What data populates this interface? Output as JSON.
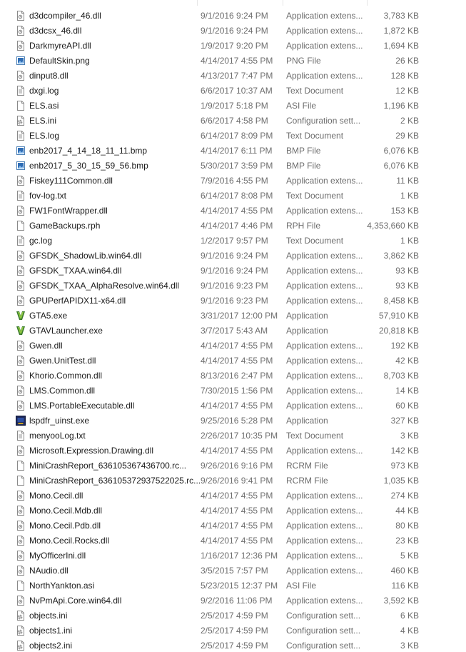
{
  "files": [
    {
      "name": "d3dcompiler_46.dll",
      "date": "9/1/2016 9:24 PM",
      "type": "Application extens...",
      "size": "3,783 KB",
      "icon": "dll-icon"
    },
    {
      "name": "d3dcsx_46.dll",
      "date": "9/1/2016 9:24 PM",
      "type": "Application extens...",
      "size": "1,872 KB",
      "icon": "dll-icon"
    },
    {
      "name": "DarkmyreAPI.dll",
      "date": "1/9/2017 9:20 PM",
      "type": "Application extens...",
      "size": "1,694 KB",
      "icon": "dll-icon"
    },
    {
      "name": "DefaultSkin.png",
      "date": "4/14/2017 4:55 PM",
      "type": "PNG File",
      "size": "26 KB",
      "icon": "image-icon"
    },
    {
      "name": "dinput8.dll",
      "date": "4/13/2017 7:47 PM",
      "type": "Application extens...",
      "size": "128 KB",
      "icon": "dll-icon"
    },
    {
      "name": "dxgi.log",
      "date": "6/6/2017 10:37 AM",
      "type": "Text Document",
      "size": "12 KB",
      "icon": "text-icon"
    },
    {
      "name": "ELS.asi",
      "date": "1/9/2017 5:18 PM",
      "type": "ASI File",
      "size": "1,196 KB",
      "icon": "file-icon"
    },
    {
      "name": "ELS.ini",
      "date": "6/6/2017 4:58 PM",
      "type": "Configuration sett...",
      "size": "2 KB",
      "icon": "config-icon"
    },
    {
      "name": "ELS.log",
      "date": "6/14/2017 8:09 PM",
      "type": "Text Document",
      "size": "29 KB",
      "icon": "text-icon"
    },
    {
      "name": "enb2017_4_14_18_11_11.bmp",
      "date": "4/14/2017 6:11 PM",
      "type": "BMP File",
      "size": "6,076 KB",
      "icon": "image-icon"
    },
    {
      "name": "enb2017_5_30_15_59_56.bmp",
      "date": "5/30/2017 3:59 PM",
      "type": "BMP File",
      "size": "6,076 KB",
      "icon": "image-icon"
    },
    {
      "name": "Fiskey111Common.dll",
      "date": "7/9/2016 4:55 PM",
      "type": "Application extens...",
      "size": "11 KB",
      "icon": "dll-icon"
    },
    {
      "name": "fov-log.txt",
      "date": "6/14/2017 8:08 PM",
      "type": "Text Document",
      "size": "1 KB",
      "icon": "text-icon"
    },
    {
      "name": "FW1FontWrapper.dll",
      "date": "4/14/2017 4:55 PM",
      "type": "Application extens...",
      "size": "153 KB",
      "icon": "dll-icon"
    },
    {
      "name": "GameBackups.rph",
      "date": "4/14/2017 4:46 PM",
      "type": "RPH File",
      "size": "4,353,660 KB",
      "icon": "file-icon"
    },
    {
      "name": "gc.log",
      "date": "1/2/2017 9:57 PM",
      "type": "Text Document",
      "size": "1 KB",
      "icon": "text-icon"
    },
    {
      "name": "GFSDK_ShadowLib.win64.dll",
      "date": "9/1/2016 9:24 PM",
      "type": "Application extens...",
      "size": "3,862 KB",
      "icon": "dll-icon"
    },
    {
      "name": "GFSDK_TXAA.win64.dll",
      "date": "9/1/2016 9:24 PM",
      "type": "Application extens...",
      "size": "93 KB",
      "icon": "dll-icon"
    },
    {
      "name": "GFSDK_TXAA_AlphaResolve.win64.dll",
      "date": "9/1/2016 9:23 PM",
      "type": "Application extens...",
      "size": "93 KB",
      "icon": "dll-icon"
    },
    {
      "name": "GPUPerfAPIDX11-x64.dll",
      "date": "9/1/2016 9:23 PM",
      "type": "Application extens...",
      "size": "8,458 KB",
      "icon": "dll-icon"
    },
    {
      "name": "GTA5.exe",
      "date": "3/31/2017 12:00 PM",
      "type": "Application",
      "size": "57,910 KB",
      "icon": "gta-icon"
    },
    {
      "name": "GTAVLauncher.exe",
      "date": "3/7/2017 5:43 AM",
      "type": "Application",
      "size": "20,818 KB",
      "icon": "gta-icon"
    },
    {
      "name": "Gwen.dll",
      "date": "4/14/2017 4:55 PM",
      "type": "Application extens...",
      "size": "192 KB",
      "icon": "dll-icon"
    },
    {
      "name": "Gwen.UnitTest.dll",
      "date": "4/14/2017 4:55 PM",
      "type": "Application extens...",
      "size": "42 KB",
      "icon": "dll-icon"
    },
    {
      "name": "Khorio.Common.dll",
      "date": "8/13/2016 2:47 PM",
      "type": "Application extens...",
      "size": "8,703 KB",
      "icon": "dll-icon"
    },
    {
      "name": "LMS.Common.dll",
      "date": "7/30/2015 1:56 PM",
      "type": "Application extens...",
      "size": "14 KB",
      "icon": "dll-icon"
    },
    {
      "name": "LMS.PortableExecutable.dll",
      "date": "4/14/2017 4:55 PM",
      "type": "Application extens...",
      "size": "60 KB",
      "icon": "dll-icon"
    },
    {
      "name": "lspdfr_uinst.exe",
      "date": "9/25/2016 5:28 PM",
      "type": "Application",
      "size": "327 KB",
      "icon": "installer-icon"
    },
    {
      "name": "menyooLog.txt",
      "date": "2/26/2017 10:35 PM",
      "type": "Text Document",
      "size": "3 KB",
      "icon": "text-icon"
    },
    {
      "name": "Microsoft.Expression.Drawing.dll",
      "date": "4/14/2017 4:55 PM",
      "type": "Application extens...",
      "size": "142 KB",
      "icon": "dll-icon"
    },
    {
      "name": "MiniCrashReport_636105367436700.rc...",
      "date": "9/26/2016 9:16 PM",
      "type": "RCRM File",
      "size": "973 KB",
      "icon": "file-icon"
    },
    {
      "name": "MiniCrashReport_636105372937522025.rc...",
      "date": "9/26/2016 9:41 PM",
      "type": "RCRM File",
      "size": "1,035 KB",
      "icon": "file-icon"
    },
    {
      "name": "Mono.Cecil.dll",
      "date": "4/14/2017 4:55 PM",
      "type": "Application extens...",
      "size": "274 KB",
      "icon": "dll-icon"
    },
    {
      "name": "Mono.Cecil.Mdb.dll",
      "date": "4/14/2017 4:55 PM",
      "type": "Application extens...",
      "size": "44 KB",
      "icon": "dll-icon"
    },
    {
      "name": "Mono.Cecil.Pdb.dll",
      "date": "4/14/2017 4:55 PM",
      "type": "Application extens...",
      "size": "80 KB",
      "icon": "dll-icon"
    },
    {
      "name": "Mono.Cecil.Rocks.dll",
      "date": "4/14/2017 4:55 PM",
      "type": "Application extens...",
      "size": "23 KB",
      "icon": "dll-icon"
    },
    {
      "name": "MyOfficerIni.dll",
      "date": "1/16/2017 12:36 PM",
      "type": "Application extens...",
      "size": "5 KB",
      "icon": "dll-icon"
    },
    {
      "name": "NAudio.dll",
      "date": "3/5/2015 7:57 PM",
      "type": "Application extens...",
      "size": "460 KB",
      "icon": "dll-icon"
    },
    {
      "name": "NorthYankton.asi",
      "date": "5/23/2015 12:37 PM",
      "type": "ASI File",
      "size": "116 KB",
      "icon": "file-icon"
    },
    {
      "name": "NvPmApi.Core.win64.dll",
      "date": "9/2/2016 11:06 PM",
      "type": "Application extens...",
      "size": "3,592 KB",
      "icon": "dll-icon"
    },
    {
      "name": "objects.ini",
      "date": "2/5/2017 4:59 PM",
      "type": "Configuration sett...",
      "size": "6 KB",
      "icon": "config-icon"
    },
    {
      "name": "objects1.ini",
      "date": "2/5/2017 4:59 PM",
      "type": "Configuration sett...",
      "size": "4 KB",
      "icon": "config-icon"
    },
    {
      "name": "objects2.ini",
      "date": "2/5/2017 4:59 PM",
      "type": "Configuration sett...",
      "size": "3 KB",
      "icon": "config-icon"
    }
  ]
}
